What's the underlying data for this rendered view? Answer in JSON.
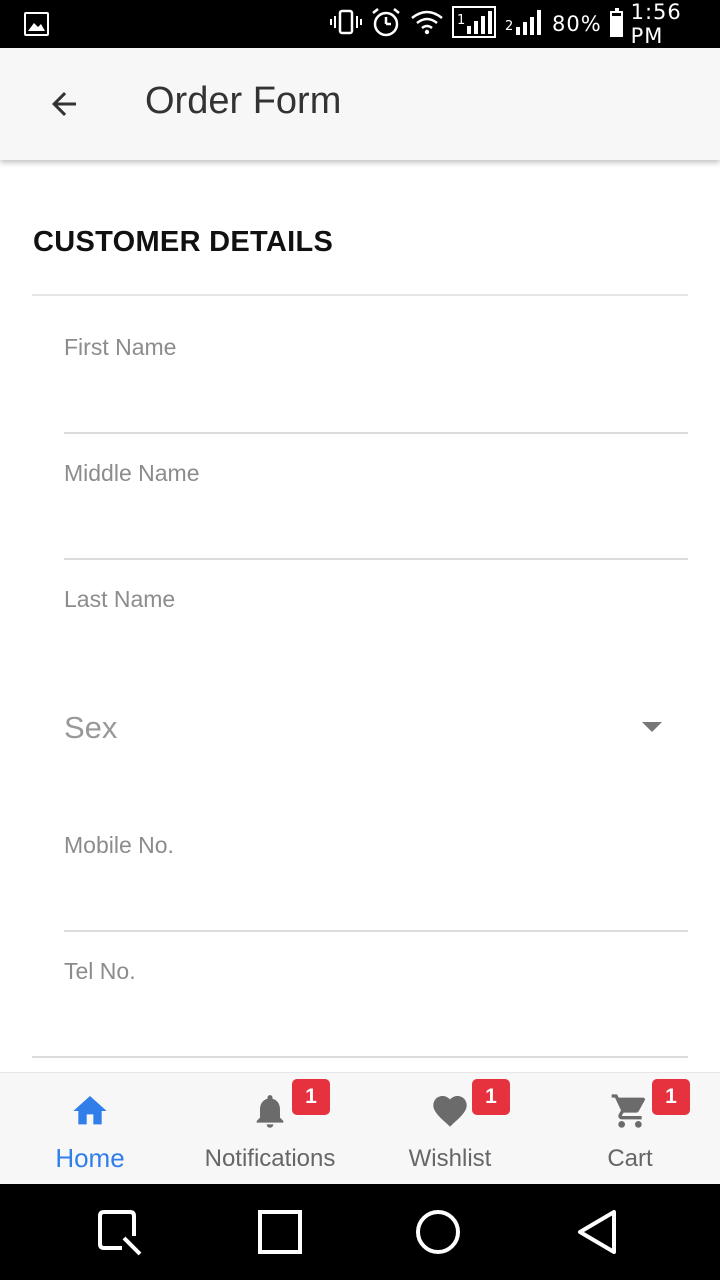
{
  "status_bar": {
    "battery_percent": "80%",
    "time": "1:56 PM",
    "sim1": "1",
    "sim2": "2",
    "icons": [
      "gallery-icon",
      "vibrate-icon",
      "alarm-icon",
      "wifi-icon",
      "signal-sim1-icon",
      "signal-sim2-icon",
      "battery-icon"
    ]
  },
  "app_bar": {
    "title": "Order Form",
    "back_icon": "arrow-back-icon"
  },
  "form": {
    "section_title": "CUSTOMER DETAILS",
    "fields": [
      {
        "label": "First Name",
        "value": ""
      },
      {
        "label": "Middle Name",
        "value": ""
      },
      {
        "label": "Last Name",
        "value": ""
      },
      {
        "label": "Mobile No.",
        "value": ""
      },
      {
        "label": "Tel No.",
        "value": ""
      }
    ],
    "sex_select": {
      "value": "Sex",
      "icon": "dropdown-arrow-icon"
    }
  },
  "bottom_nav": {
    "items": [
      {
        "label": "Home",
        "icon": "home-icon",
        "active": true
      },
      {
        "label": "Notifications",
        "icon": "bell-icon",
        "badge": "1"
      },
      {
        "label": "Wishlist",
        "icon": "heart-icon",
        "badge": "1"
      },
      {
        "label": "Cart",
        "icon": "cart-icon",
        "badge": "1"
      }
    ]
  },
  "system_nav": {
    "buttons": [
      "screenshot-icon",
      "recents-icon",
      "home-circle-icon",
      "back-triangle-icon"
    ]
  },
  "colors": {
    "accent": "#2f7ee9",
    "badge": "#e5323e",
    "label_text": "#8c8c8c",
    "app_bar_bg": "#f7f7f7"
  }
}
